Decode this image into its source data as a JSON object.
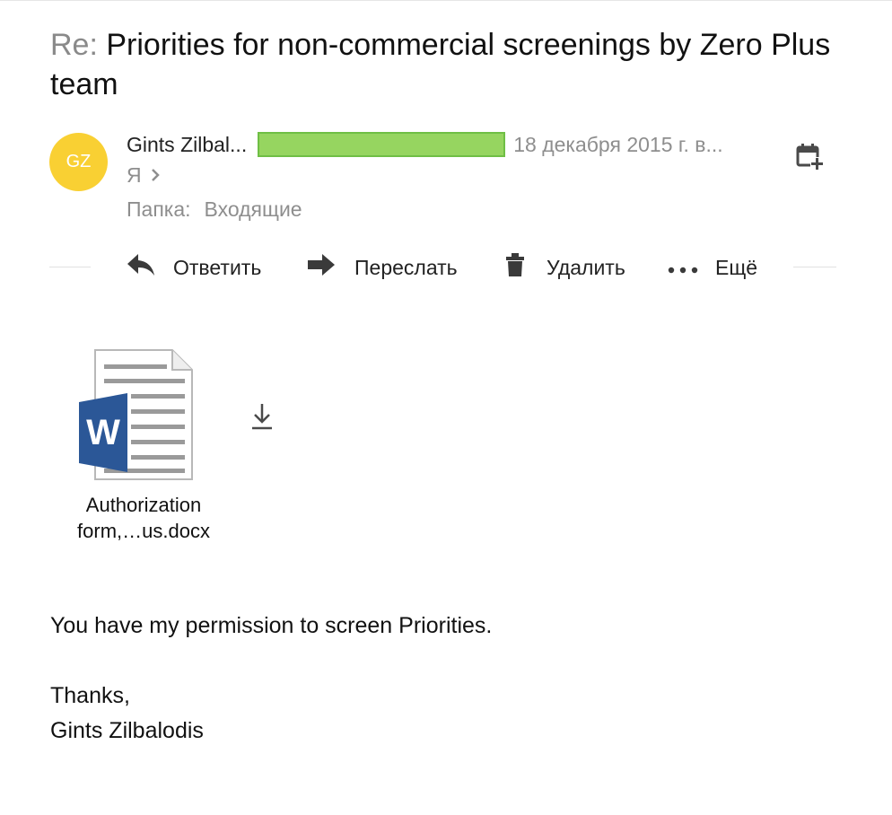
{
  "message": {
    "subject_prefix": "Re:",
    "subject": " Priorities for non-commercial screenings by Zero Plus team"
  },
  "sender": {
    "avatar_initials": "GZ",
    "name": "Gints Zilbal...",
    "date": "18 декабря 2015 г. в...",
    "avatar_color": "#f9d033"
  },
  "recipient": {
    "label": "Я"
  },
  "folder": {
    "label": "Папка:",
    "value": "Входящие"
  },
  "actions": {
    "reply": "Ответить",
    "forward": "Переслать",
    "delete": "Удалить",
    "more": "Ещё"
  },
  "attachment": {
    "name_line1": "Authorization",
    "name_line2": "form,…us.docx",
    "icon": "word-document-icon"
  },
  "body": {
    "line1": "You have my permission to screen Priorities.",
    "line2": "Thanks,",
    "line3": "Gints Zilbalodis"
  },
  "colors": {
    "redaction_fill": "#96d560",
    "word_blue": "#2b5797",
    "muted_text": "#8e8e8e"
  }
}
